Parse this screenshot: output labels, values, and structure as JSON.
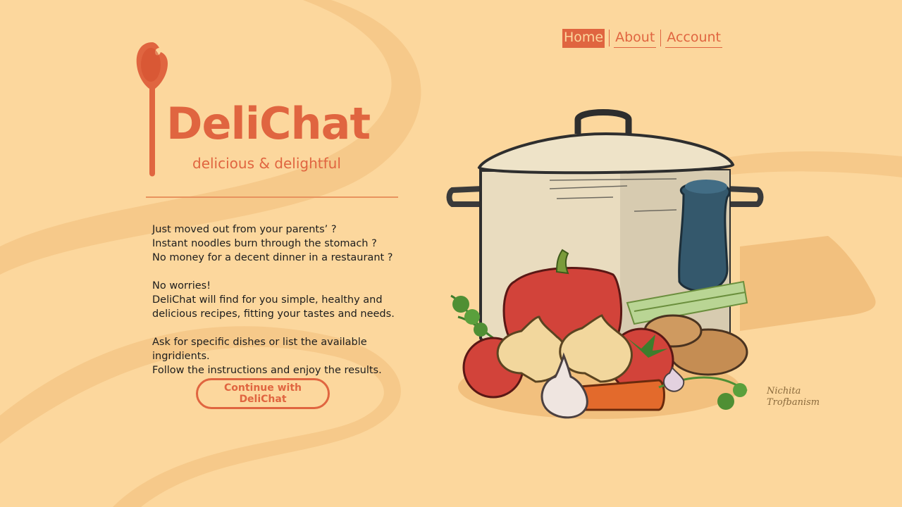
{
  "brand": {
    "name": "DeliChat",
    "tagline": "delicious & delightful"
  },
  "nav": {
    "items": [
      {
        "label": "Home",
        "active": true
      },
      {
        "label": "About",
        "active": false
      },
      {
        "label": "Account",
        "active": false
      }
    ]
  },
  "intro": {
    "paragraphs": [
      [
        "Just moved out from your parents’ ?",
        "Instant noodles burn through the stomach ?",
        "No money for a decent dinner in a restaurant ?"
      ],
      [
        "No worries!",
        "DeliChat will find for you simple, healthy and",
        "delicious recipes, fitting your tastes and needs."
      ],
      [
        "Ask for specific dishes or list the available ingridients.",
        "Follow the instructions and enjoy the results."
      ]
    ]
  },
  "cta": {
    "label": "Continue with DeliChat"
  },
  "illustration": {
    "signature_lines": [
      "Nichita",
      "Trofbanism"
    ]
  },
  "colors": {
    "background": "#fcd79d",
    "accent": "#e06540",
    "text": "#1d1d1d"
  }
}
